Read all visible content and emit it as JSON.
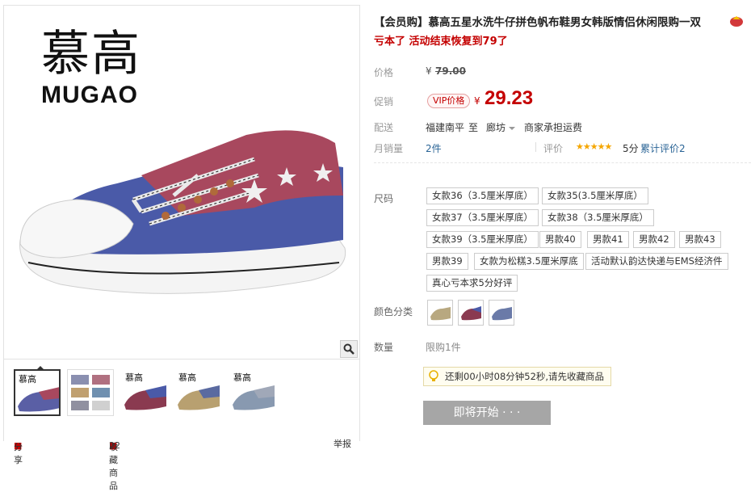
{
  "gallery": {
    "brand_cn": "慕高",
    "brand_en": "MUGAO",
    "thumb_brand": "慕高",
    "bottom_left": "分享",
    "bottom_mid": "收藏商品",
    "bottom_mid_count": "22",
    "bottom_right": "举报"
  },
  "product": {
    "title": "【会员购】慕高五星水洗牛仔拼色帆布鞋男女韩版情侣休闲限购一双",
    "subtitle": "亏本了 活动结束恢复到79了",
    "price_label": "价格",
    "old_price_currency": "¥",
    "old_price": "79.00",
    "promo_label": "促销",
    "vip_badge": "VIP价格",
    "currency": "¥",
    "price": "29.23",
    "delivery_label": "配送",
    "delivery_from": "福建南平",
    "delivery_to_word": "至",
    "delivery_to": "廊坊",
    "delivery_fee": "商家承担运费",
    "sales_label": "月销量",
    "sales_value": "2件",
    "rating_label": "评价",
    "rating_stars": "★★★★★",
    "rating_score": "5分",
    "review_count": "累计评价2",
    "size_label": "尺码",
    "sizes": [
      "女款36（3.5厘米厚底）",
      "女款35(3.5厘米厚底）",
      "女款37（3.5厘米厚底）",
      "女款38（3.5厘米厚底）",
      "女款39（3.5厘米厚底）",
      "男款40",
      "男款41",
      "男款42",
      "男款43",
      "男款39",
      "女款为松糕3.5厘米厚底",
      "活动默认韵达快递与EMS经济件",
      "真心亏本求5分好评"
    ],
    "color_label": "颜色分类",
    "qty_label": "数量",
    "qty_value": "限购1件",
    "countdown": "还剩00小时08分钟52秒,请先收藏商品",
    "buy_button": "即将开始 · · ·"
  },
  "colors": {
    "price_red": "#c40000",
    "button_gray": "#a6a6a6"
  }
}
